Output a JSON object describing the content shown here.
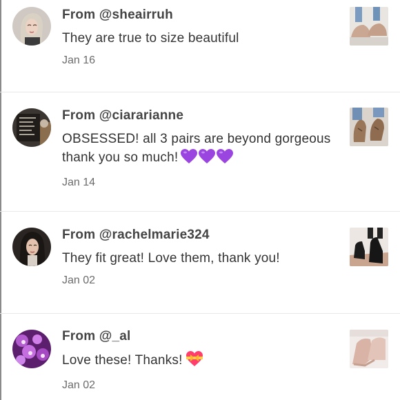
{
  "reviews": [
    {
      "from": "From @sheairruh",
      "text": "They are true to size beautiful",
      "date": "Jan 16",
      "emoji": []
    },
    {
      "from": "From @ciararianne",
      "text": "OBSESSED! all 3 pairs are beyond gorgeous thank you so much!",
      "date": "Jan 14",
      "emoji": [
        "purple-heart-icon",
        "purple-heart-icon",
        "purple-heart-icon"
      ]
    },
    {
      "from": "From @rachelmarie324",
      "text": "They fit great! Love them, thank you!",
      "date": "Jan 02",
      "emoji": []
    },
    {
      "from": "From @_al",
      "text": "Love these! Thanks!",
      "date": "Jan 02",
      "emoji": [
        "heart-with-ribbon-icon"
      ]
    }
  ],
  "colors": {
    "purple_heart": "#9b45e0",
    "ribbon_heart": "#ff3e6c",
    "ribbon": "#ffd23f",
    "divider": "#e8e8e8"
  }
}
